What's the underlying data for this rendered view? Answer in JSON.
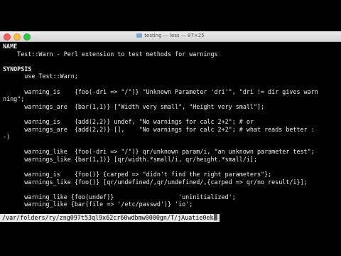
{
  "window": {
    "title": "testing — less — 87×25"
  },
  "terminal": {
    "lines": [
      "NAME",
      "    Test::Warn - Perl extension to test methods for warnings",
      "",
      "SYNOPSIS",
      "      use Test::Warn;",
      "",
      "      warning_is    {foo(-dri => \"/\")} \"Unknown Parameter 'dri'\", \"dri != dir gives warn",
      "ning\";",
      "      warnings_are  {bar(1,1)} [\"Width very small\", \"Height very small\"];",
      "",
      "      warning_is    {add(2,2)} undef, \"No warnings for calc 2+2\"; # or",
      "      warnings_are  {add(2,2)} [],    \"No warnings for calc 2+2\"; # what reads better :",
      "-)",
      "",
      "      warning_like  {foo(-dri => \"/\")} qr/unknown param/i, \"an unknown parameter test\";",
      "      warnings_like {bar(1,1)} [qr/width.*small/i, qr/height.*small/i];",
      "",
      "      warning_is    {foo()} {carped => \"didn't find the right parameters\"};",
      "      warnings_like {foo()} [qr/undefined/,qr/undefined/,{carped => qr/no result/i}];",
      "",
      "      warning_like {foo(undef)}                  'uninitialized';",
      "      warning_like {bar(file => '/etc/passwd')} 'io';"
    ],
    "status": "/var/folders/ry/zng097t53ql9x62cr60wdbmw0000gn/T/jAuatie0ek"
  },
  "colors": {
    "background": "#000000",
    "text": "#f0f0f0",
    "status_bg": "#e8e8e8"
  }
}
